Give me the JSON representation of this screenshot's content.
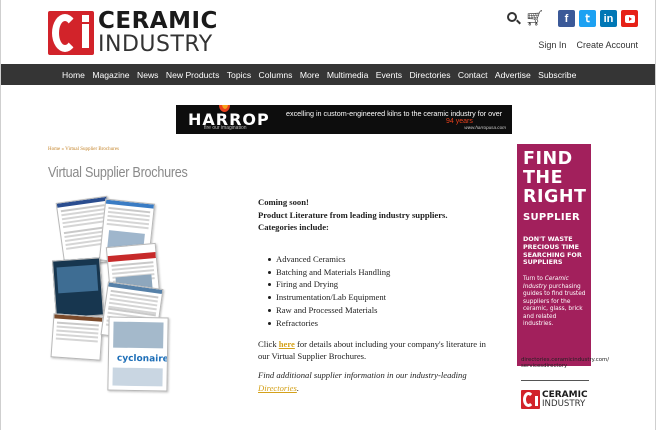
{
  "header": {
    "logo_line1": "CERAMIC",
    "logo_line2": "INDUSTRY",
    "social": [
      {
        "name": "facebook-icon",
        "glyph": "f",
        "color": "#3b5998"
      },
      {
        "name": "twitter-icon",
        "glyph": "t",
        "color": "#1da1f2"
      },
      {
        "name": "linkedin-icon",
        "glyph": "in",
        "color": "#0077b5"
      },
      {
        "name": "youtube-icon",
        "glyph": "",
        "color": "#e62117"
      }
    ],
    "sign_in": "Sign In",
    "create_account": "Create Account"
  },
  "nav": {
    "items": [
      "Home",
      "Magazine",
      "News",
      "New Products",
      "Topics",
      "Columns",
      "More",
      "Multimedia",
      "Events",
      "Directories",
      "Contact",
      "Advertise",
      "Subscribe"
    ]
  },
  "banner": {
    "brand": "HARROP",
    "tagline": "fire our imagination",
    "message": "excelling in custom-engineered kilns to the ceramic industry for over",
    "years": "94 years",
    "url": "www.harropusa.com"
  },
  "breadcrumb": "Home » Virtual Supplier Brochures",
  "page_title": "Virtual Supplier Brochures",
  "content": {
    "intro_line1": "Coming soon!",
    "intro_line2": "Product Literature from leading industry suppliers.",
    "intro_line3": "Categories include:",
    "categories": [
      "Advanced Ceramics",
      "Batching and Materials Handling",
      "Firing and Drying",
      "Instrumentation/Lab Equipment",
      "Raw and Processed Materials",
      "Refractories"
    ],
    "para1_before": "Click ",
    "para1_link": "here",
    "para1_after": " for details about including your company's literature in our Virtual Supplier Brochures.",
    "para2_before": "Find additional supplier information in our industry-leading ",
    "para2_link": "Directories",
    "para2_after": "."
  },
  "sidebar_ad": {
    "line1": "FIND",
    "line2": "THE",
    "line3": "RIGHT",
    "line4": "SUPPLIER",
    "waste": "DON'T WASTE PRECIOUS TIME SEARCHING FOR SUPPLIERS",
    "turn_before": "Turn to ",
    "turn_em": "Ceramic Industry",
    "turn_after": " purchasing guides to find trusted suppliers for the ceramic, glass, brick and related industries.",
    "goto_label": "GO TO:",
    "goto_url": "directories.ceramicindustry.com/ servicesdirectory",
    "logo_line1": "CERAMIC",
    "logo_line2": "INDUSTRY",
    "bg_color": "#a2205c"
  }
}
